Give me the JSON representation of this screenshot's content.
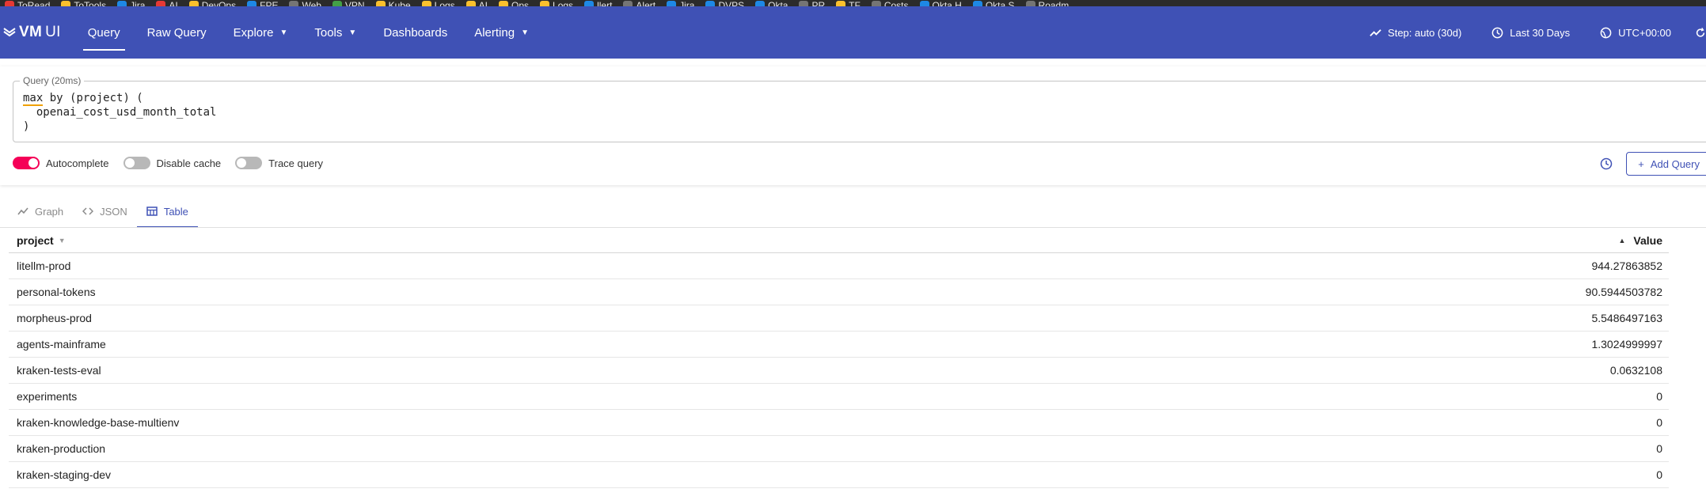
{
  "bookmarks": [
    {
      "label": "ToRead",
      "color": "#e53935"
    },
    {
      "label": "ToTools",
      "color": "#fbc02d"
    },
    {
      "label": "Jira",
      "color": "#1e88e5"
    },
    {
      "label": "AI",
      "color": "#e53935"
    },
    {
      "label": "DevOps",
      "color": "#fbc02d"
    },
    {
      "label": "FPE",
      "color": "#1e88e5"
    },
    {
      "label": "Web",
      "color": "#757575"
    },
    {
      "label": "VPN",
      "color": "#43a047"
    },
    {
      "label": "Kube",
      "color": "#fbc02d"
    },
    {
      "label": "Logs",
      "color": "#fbc02d"
    },
    {
      "label": "AI",
      "color": "#fbc02d"
    },
    {
      "label": "Ops",
      "color": "#fbc02d"
    },
    {
      "label": "Logs",
      "color": "#fbc02d"
    },
    {
      "label": "llert",
      "color": "#1e88e5"
    },
    {
      "label": "Alert",
      "color": "#757575"
    },
    {
      "label": "Jira",
      "color": "#1e88e5"
    },
    {
      "label": "DVPS",
      "color": "#1e88e5"
    },
    {
      "label": "Okta",
      "color": "#1e88e5"
    },
    {
      "label": "PR",
      "color": "#757575"
    },
    {
      "label": "TF",
      "color": "#fbc02d"
    },
    {
      "label": "Costs",
      "color": "#757575"
    },
    {
      "label": "Okta H",
      "color": "#1e88e5"
    },
    {
      "label": "Okta S",
      "color": "#1e88e5"
    },
    {
      "label": "Roadm",
      "color": "#757575"
    }
  ],
  "header": {
    "logo_text": "VM",
    "logo_suffix": "UI",
    "nav": [
      {
        "label": "Query",
        "active": true,
        "dropdown": false
      },
      {
        "label": "Raw Query",
        "active": false,
        "dropdown": false
      },
      {
        "label": "Explore",
        "active": false,
        "dropdown": true
      },
      {
        "label": "Tools",
        "active": false,
        "dropdown": true
      },
      {
        "label": "Dashboards",
        "active": false,
        "dropdown": false
      },
      {
        "label": "Alerting",
        "active": false,
        "dropdown": true
      }
    ],
    "step_label": "Step: auto (30d)",
    "time_range_label": "Last 30 Days",
    "timezone_label": "UTC+00:00"
  },
  "query": {
    "legend": "Query (20ms)",
    "line1_kw": "max",
    "line1_rest": " by (project) (",
    "line2": "  openai_cost_usd_month_total",
    "line3": ")"
  },
  "toggles": {
    "autocomplete": {
      "label": "Autocomplete",
      "on": true
    },
    "disable_cache": {
      "label": "Disable cache",
      "on": false
    },
    "trace_query": {
      "label": "Trace query",
      "on": false
    }
  },
  "actions": {
    "add_query_label": "Add Query"
  },
  "tabs": [
    {
      "label": "Graph",
      "icon": "chart-line-icon",
      "active": false
    },
    {
      "label": "JSON",
      "icon": "code-icon",
      "active": false
    },
    {
      "label": "Table",
      "icon": "table-icon",
      "active": true
    }
  ],
  "table": {
    "col_project": "project",
    "col_value": "Value",
    "rows": [
      {
        "project": "litellm-prod",
        "value": "944.27863852"
      },
      {
        "project": "personal-tokens",
        "value": "90.5944503782"
      },
      {
        "project": "morpheus-prod",
        "value": "5.5486497163"
      },
      {
        "project": "agents-mainframe",
        "value": "1.3024999997"
      },
      {
        "project": "kraken-tests-eval",
        "value": "0.0632108"
      },
      {
        "project": "experiments",
        "value": "0"
      },
      {
        "project": "kraken-knowledge-base-multienv",
        "value": "0"
      },
      {
        "project": "kraken-production",
        "value": "0"
      },
      {
        "project": "kraken-staging-dev",
        "value": "0"
      }
    ]
  },
  "colors": {
    "header_bg": "#3f51b5",
    "accent": "#3f51b5",
    "toggle_on": "#f50057"
  }
}
